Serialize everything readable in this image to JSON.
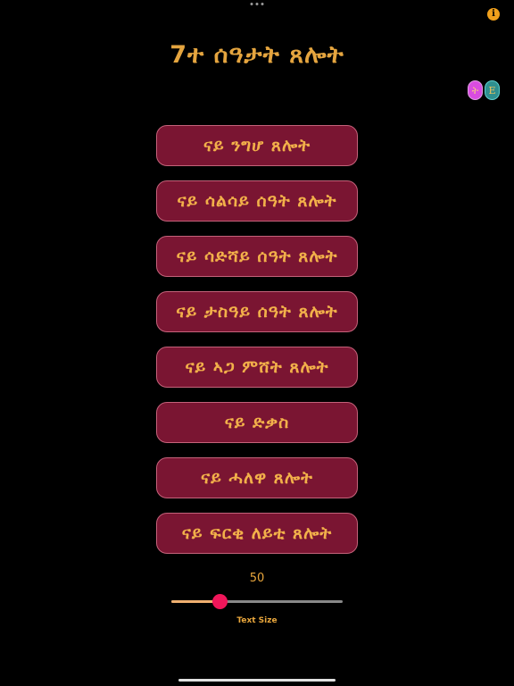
{
  "header": {
    "info_icon_glyph": "i",
    "title": "7ተ ሰዓታት ጸሎት"
  },
  "language_toggle": {
    "tigrinya_label": "ት",
    "english_label": "E"
  },
  "menu": {
    "items": [
      {
        "label": "ናይ ንግሆ ጸሎት"
      },
      {
        "label": "ናይ ሳልሳይ ሰዓት ጸሎት"
      },
      {
        "label": "ናይ ሳድሻይ ሰዓት ጸሎት"
      },
      {
        "label": "ናይ ታስዓይ ሰዓት ጸሎት"
      },
      {
        "label": "ናይ ኣጋ ምሸት ጸሎት"
      },
      {
        "label": "ናይ ድቃስ"
      },
      {
        "label": "ናይ ሓለዋ ጸሎት"
      },
      {
        "label": "ናይ ፍርቂ ለይቲ ጸሎት"
      }
    ]
  },
  "text_size": {
    "value": "50",
    "label": "Text Size",
    "fraction": 0.28
  },
  "colors": {
    "accent": "#e5a53f",
    "button_bg": "#7a1532",
    "slider_thumb": "#f0165a"
  }
}
